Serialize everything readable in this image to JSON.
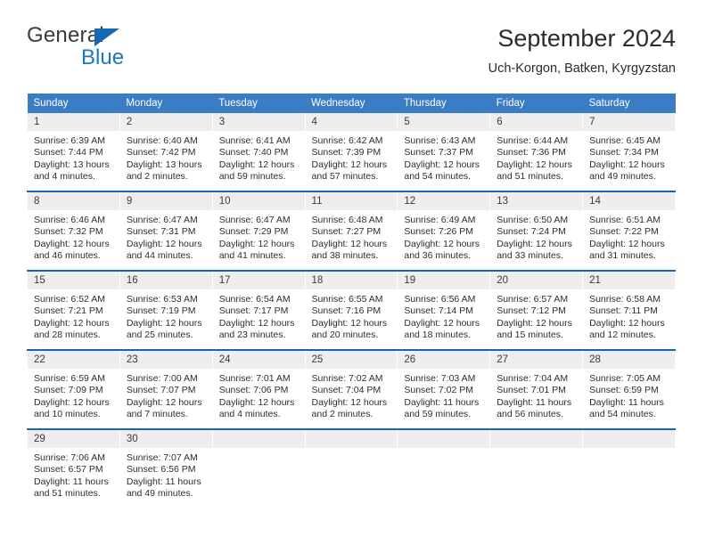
{
  "brand": {
    "name_part1": "General",
    "name_part2": "Blue",
    "triangle_color": "#1667b2",
    "blue_color": "#1877c9"
  },
  "header": {
    "title": "September 2024",
    "subtitle": "Uch-Korgon, Batken, Kyrgyzstan"
  },
  "theme": {
    "header_bg": "#3b7dc4",
    "row_accent": "#1667b2",
    "daynum_bg": "#eeeeee",
    "text": "#2e2e2e"
  },
  "weekday_headers": [
    "Sunday",
    "Monday",
    "Tuesday",
    "Wednesday",
    "Thursday",
    "Friday",
    "Saturday"
  ],
  "weeks": [
    [
      {
        "day": "1",
        "sunrise": "Sunrise: 6:39 AM",
        "sunset": "Sunset: 7:44 PM",
        "daylight": "Daylight: 13 hours and 4 minutes."
      },
      {
        "day": "2",
        "sunrise": "Sunrise: 6:40 AM",
        "sunset": "Sunset: 7:42 PM",
        "daylight": "Daylight: 13 hours and 2 minutes."
      },
      {
        "day": "3",
        "sunrise": "Sunrise: 6:41 AM",
        "sunset": "Sunset: 7:40 PM",
        "daylight": "Daylight: 12 hours and 59 minutes."
      },
      {
        "day": "4",
        "sunrise": "Sunrise: 6:42 AM",
        "sunset": "Sunset: 7:39 PM",
        "daylight": "Daylight: 12 hours and 57 minutes."
      },
      {
        "day": "5",
        "sunrise": "Sunrise: 6:43 AM",
        "sunset": "Sunset: 7:37 PM",
        "daylight": "Daylight: 12 hours and 54 minutes."
      },
      {
        "day": "6",
        "sunrise": "Sunrise: 6:44 AM",
        "sunset": "Sunset: 7:36 PM",
        "daylight": "Daylight: 12 hours and 51 minutes."
      },
      {
        "day": "7",
        "sunrise": "Sunrise: 6:45 AM",
        "sunset": "Sunset: 7:34 PM",
        "daylight": "Daylight: 12 hours and 49 minutes."
      }
    ],
    [
      {
        "day": "8",
        "sunrise": "Sunrise: 6:46 AM",
        "sunset": "Sunset: 7:32 PM",
        "daylight": "Daylight: 12 hours and 46 minutes."
      },
      {
        "day": "9",
        "sunrise": "Sunrise: 6:47 AM",
        "sunset": "Sunset: 7:31 PM",
        "daylight": "Daylight: 12 hours and 44 minutes."
      },
      {
        "day": "10",
        "sunrise": "Sunrise: 6:47 AM",
        "sunset": "Sunset: 7:29 PM",
        "daylight": "Daylight: 12 hours and 41 minutes."
      },
      {
        "day": "11",
        "sunrise": "Sunrise: 6:48 AM",
        "sunset": "Sunset: 7:27 PM",
        "daylight": "Daylight: 12 hours and 38 minutes."
      },
      {
        "day": "12",
        "sunrise": "Sunrise: 6:49 AM",
        "sunset": "Sunset: 7:26 PM",
        "daylight": "Daylight: 12 hours and 36 minutes."
      },
      {
        "day": "13",
        "sunrise": "Sunrise: 6:50 AM",
        "sunset": "Sunset: 7:24 PM",
        "daylight": "Daylight: 12 hours and 33 minutes."
      },
      {
        "day": "14",
        "sunrise": "Sunrise: 6:51 AM",
        "sunset": "Sunset: 7:22 PM",
        "daylight": "Daylight: 12 hours and 31 minutes."
      }
    ],
    [
      {
        "day": "15",
        "sunrise": "Sunrise: 6:52 AM",
        "sunset": "Sunset: 7:21 PM",
        "daylight": "Daylight: 12 hours and 28 minutes."
      },
      {
        "day": "16",
        "sunrise": "Sunrise: 6:53 AM",
        "sunset": "Sunset: 7:19 PM",
        "daylight": "Daylight: 12 hours and 25 minutes."
      },
      {
        "day": "17",
        "sunrise": "Sunrise: 6:54 AM",
        "sunset": "Sunset: 7:17 PM",
        "daylight": "Daylight: 12 hours and 23 minutes."
      },
      {
        "day": "18",
        "sunrise": "Sunrise: 6:55 AM",
        "sunset": "Sunset: 7:16 PM",
        "daylight": "Daylight: 12 hours and 20 minutes."
      },
      {
        "day": "19",
        "sunrise": "Sunrise: 6:56 AM",
        "sunset": "Sunset: 7:14 PM",
        "daylight": "Daylight: 12 hours and 18 minutes."
      },
      {
        "day": "20",
        "sunrise": "Sunrise: 6:57 AM",
        "sunset": "Sunset: 7:12 PM",
        "daylight": "Daylight: 12 hours and 15 minutes."
      },
      {
        "day": "21",
        "sunrise": "Sunrise: 6:58 AM",
        "sunset": "Sunset: 7:11 PM",
        "daylight": "Daylight: 12 hours and 12 minutes."
      }
    ],
    [
      {
        "day": "22",
        "sunrise": "Sunrise: 6:59 AM",
        "sunset": "Sunset: 7:09 PM",
        "daylight": "Daylight: 12 hours and 10 minutes."
      },
      {
        "day": "23",
        "sunrise": "Sunrise: 7:00 AM",
        "sunset": "Sunset: 7:07 PM",
        "daylight": "Daylight: 12 hours and 7 minutes."
      },
      {
        "day": "24",
        "sunrise": "Sunrise: 7:01 AM",
        "sunset": "Sunset: 7:06 PM",
        "daylight": "Daylight: 12 hours and 4 minutes."
      },
      {
        "day": "25",
        "sunrise": "Sunrise: 7:02 AM",
        "sunset": "Sunset: 7:04 PM",
        "daylight": "Daylight: 12 hours and 2 minutes."
      },
      {
        "day": "26",
        "sunrise": "Sunrise: 7:03 AM",
        "sunset": "Sunset: 7:02 PM",
        "daylight": "Daylight: 11 hours and 59 minutes."
      },
      {
        "day": "27",
        "sunrise": "Sunrise: 7:04 AM",
        "sunset": "Sunset: 7:01 PM",
        "daylight": "Daylight: 11 hours and 56 minutes."
      },
      {
        "day": "28",
        "sunrise": "Sunrise: 7:05 AM",
        "sunset": "Sunset: 6:59 PM",
        "daylight": "Daylight: 11 hours and 54 minutes."
      }
    ],
    [
      {
        "day": "29",
        "sunrise": "Sunrise: 7:06 AM",
        "sunset": "Sunset: 6:57 PM",
        "daylight": "Daylight: 11 hours and 51 minutes."
      },
      {
        "day": "30",
        "sunrise": "Sunrise: 7:07 AM",
        "sunset": "Sunset: 6:56 PM",
        "daylight": "Daylight: 11 hours and 49 minutes."
      },
      {
        "day": "",
        "sunrise": "",
        "sunset": "",
        "daylight": ""
      },
      {
        "day": "",
        "sunrise": "",
        "sunset": "",
        "daylight": ""
      },
      {
        "day": "",
        "sunrise": "",
        "sunset": "",
        "daylight": ""
      },
      {
        "day": "",
        "sunrise": "",
        "sunset": "",
        "daylight": ""
      },
      {
        "day": "",
        "sunrise": "",
        "sunset": "",
        "daylight": ""
      }
    ]
  ]
}
